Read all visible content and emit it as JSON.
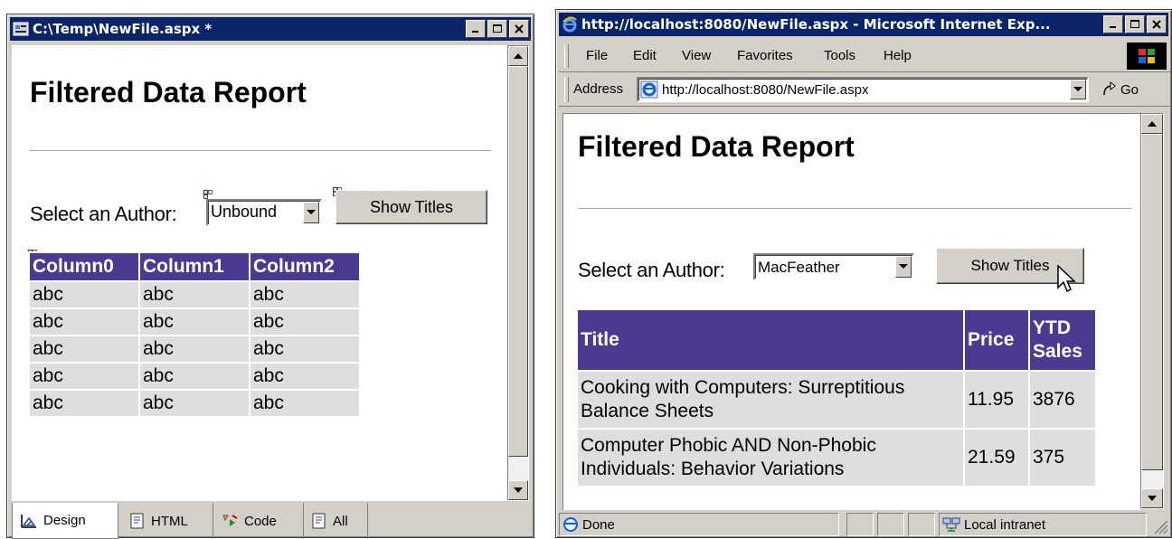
{
  "left_window": {
    "title": "C:\\Temp\\NewFile.aspx *",
    "heading": "Filtered Data Report",
    "author_label": "Select an Author:",
    "author_value": "Unbound",
    "button_label": "Show Titles",
    "grid": {
      "headers": [
        "Column0",
        "Column1",
        "Column2"
      ],
      "rows": [
        [
          "abc",
          "abc",
          "abc"
        ],
        [
          "abc",
          "abc",
          "abc"
        ],
        [
          "abc",
          "abc",
          "abc"
        ],
        [
          "abc",
          "abc",
          "abc"
        ],
        [
          "abc",
          "abc",
          "abc"
        ]
      ]
    },
    "tabs": [
      "Design",
      "HTML",
      "Code",
      "All"
    ]
  },
  "right_window": {
    "title": "http://localhost:8080/NewFile.aspx - Microsoft Internet Exp...",
    "menu": [
      "File",
      "Edit",
      "View",
      "Favorites",
      "Tools",
      "Help"
    ],
    "address_label": "Address",
    "address_value": "http://localhost:8080/NewFile.aspx",
    "go_label": "Go",
    "heading": "Filtered Data Report",
    "author_label": "Select an Author:",
    "author_value": "MacFeather",
    "button_label": "Show Titles",
    "table": {
      "headers": [
        "Title",
        "Price",
        "YTD Sales"
      ],
      "rows": [
        [
          "Cooking with Computers: Surreptitious Balance Sheets",
          "11.95",
          "3876"
        ],
        [
          "Computer Phobic AND Non-Phobic Individuals: Behavior Variations",
          "21.59",
          "375"
        ]
      ]
    },
    "status_left": "Done",
    "status_zone": "Local intranet"
  },
  "colors": {
    "title_bar": "#0a246a",
    "header_bg": "#4b3a8f",
    "row_bg": "#dedede",
    "chrome": "#d4d0c8"
  }
}
